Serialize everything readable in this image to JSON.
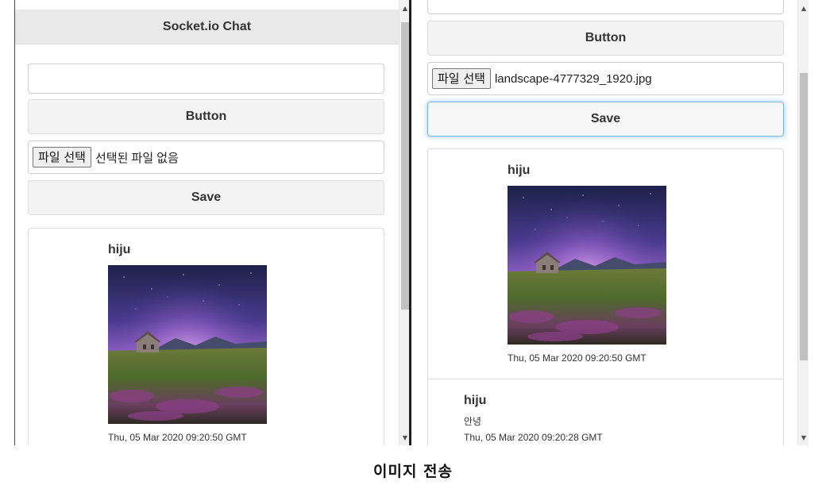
{
  "left_window": {
    "header_title": "Socket.io Chat",
    "text_input_value": "",
    "button_label": "Button",
    "file_picker": {
      "button_label": "파일 선택",
      "status_text": "선택된 파일 없음"
    },
    "save_label": "Save",
    "messages": [
      {
        "author": "hiju",
        "image": "landscape-image",
        "timestamp": "Thu, 05 Mar 2020 09:20:50 GMT"
      }
    ]
  },
  "right_window": {
    "button_label": "Button",
    "file_picker": {
      "button_label": "파일 선택",
      "file_name": "landscape-4777329_1920.jpg"
    },
    "save_label": "Save",
    "messages": [
      {
        "author": "hiju",
        "image": "landscape-image",
        "timestamp": "Thu, 05 Mar 2020 09:20:50 GMT"
      },
      {
        "author": "hiju",
        "text": "안녕",
        "timestamp": "Thu, 05 Mar 2020 09:20:28 GMT"
      }
    ]
  },
  "caption": "이미지 전송",
  "icons": {
    "scroll_up": "scroll-up-arrow-icon",
    "scroll_down": "scroll-down-arrow-icon"
  },
  "colors": {
    "header_background": "#e9e9e9",
    "button_background": "#f4f4f4",
    "focus_ring": "#66afe9",
    "scrollbar_thumb": "#c1c1c1"
  }
}
